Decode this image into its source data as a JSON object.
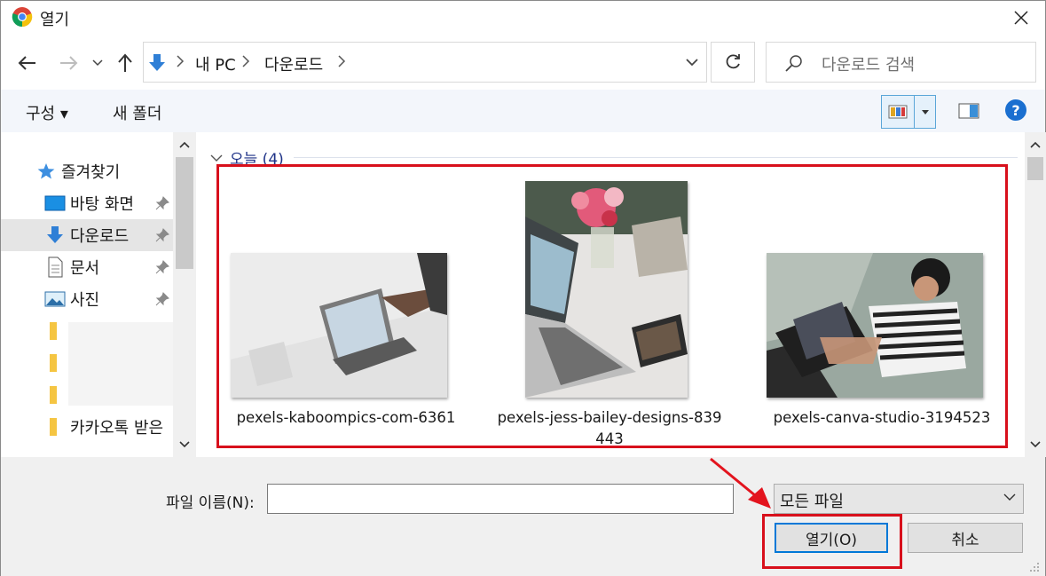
{
  "window": {
    "title": "열기"
  },
  "address": {
    "crumbs": [
      "내 PC",
      "다운로드"
    ]
  },
  "search": {
    "placeholder": "다운로드 검색"
  },
  "toolbar": {
    "organize_label": "구성 ▾",
    "new_folder_label": "새 폴더"
  },
  "sidebar": {
    "items": [
      {
        "label": "즐겨찾기",
        "icon": "star-icon"
      },
      {
        "label": "바탕 화면",
        "icon": "desktop-icon",
        "pinned": true
      },
      {
        "label": "다운로드",
        "icon": "download-arrow-icon",
        "pinned": true,
        "selected": true
      },
      {
        "label": "문서",
        "icon": "document-icon",
        "pinned": true
      },
      {
        "label": "사진",
        "icon": "picture-icon",
        "pinned": true
      },
      {
        "label": "카카오톡 받은",
        "icon": "folder-icon"
      }
    ]
  },
  "content": {
    "group_label": "오늘 (4)",
    "files": [
      {
        "name": "pexels-kaboompics-com-6361"
      },
      {
        "name_line1": "pexels-jess-bailey-designs-839",
        "name_line2": "443"
      },
      {
        "name": "pexels-canva-studio-3194523"
      }
    ]
  },
  "bottom": {
    "file_name_label": "파일 이름(N):",
    "file_name_value": "",
    "filter_value": "모든 파일",
    "open_label": "열기(O)",
    "cancel_label": "취소"
  },
  "colors": {
    "accent": "#0078d7",
    "highlight": "#d8101c",
    "group_text": "#1e3287"
  }
}
